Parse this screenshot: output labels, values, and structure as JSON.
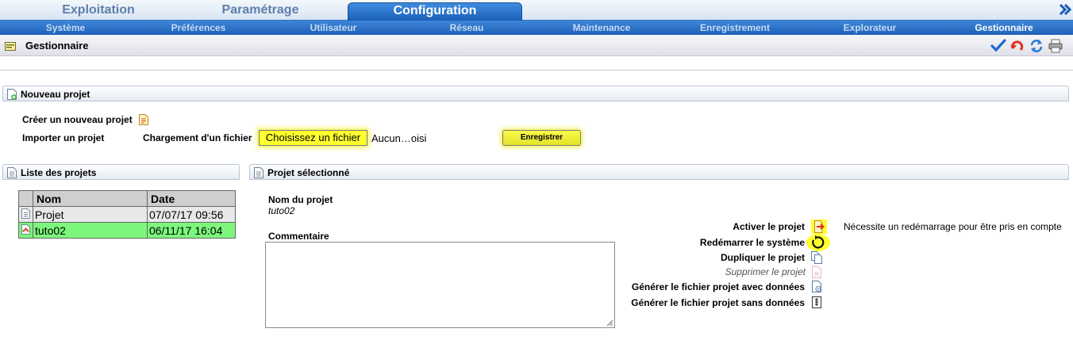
{
  "top_tabs": [
    {
      "label": "Exploitation"
    },
    {
      "label": "Paramétrage"
    },
    {
      "label": "Configuration"
    }
  ],
  "sub_tabs": [
    {
      "label": "Système"
    },
    {
      "label": "Préférences"
    },
    {
      "label": "Utilisateur"
    },
    {
      "label": "Réseau"
    },
    {
      "label": "Maintenance"
    },
    {
      "label": "Enregistrement"
    },
    {
      "label": "Explorateur"
    },
    {
      "label": "Gestionnaire"
    }
  ],
  "page_title": "Gestionnaire",
  "new_project": {
    "header": "Nouveau projet",
    "create_label": "Créer un nouveau projet",
    "import_label": "Importer un projet",
    "file_label": "Chargement d'un fichier",
    "file_button": "Choisissez un fichier",
    "file_status": "Aucun…oisi",
    "save_button": "Enregistrer"
  },
  "project_list": {
    "header": "Liste des projets",
    "columns": [
      "Nom",
      "Date"
    ],
    "rows": [
      {
        "name": "Projet",
        "date": "07/07/17 09:56",
        "active": false
      },
      {
        "name": "tuto02",
        "date": "06/11/17 16:04",
        "active": true
      }
    ]
  },
  "selected_project": {
    "header": "Projet sélectionné",
    "name_label": "Nom du projet",
    "name_value": "tuto02",
    "comment_label": "Commentaire",
    "comment_value": "",
    "actions": [
      {
        "label": "Activer le projet",
        "icon": "activate-icon",
        "enabled": true
      },
      {
        "label": "Redémarrer le système",
        "icon": "restart-icon",
        "enabled": true
      },
      {
        "label": "Dupliquer le projet",
        "icon": "duplicate-icon",
        "enabled": true
      },
      {
        "label": "Supprimer le projet",
        "icon": "delete-icon",
        "enabled": false
      },
      {
        "label": "Générer le fichier projet avec données",
        "icon": "export-with-data-icon",
        "enabled": true
      },
      {
        "label": "Générer le fichier projet sans données",
        "icon": "export-without-data-icon",
        "enabled": true
      }
    ],
    "restart_note": "Nécessite un redémarrage pour être pris en compte"
  },
  "colors": {
    "tab_blue": "#1f61b9",
    "highlight_yellow": "#ffff2e",
    "active_row_green": "#7cf77c"
  }
}
